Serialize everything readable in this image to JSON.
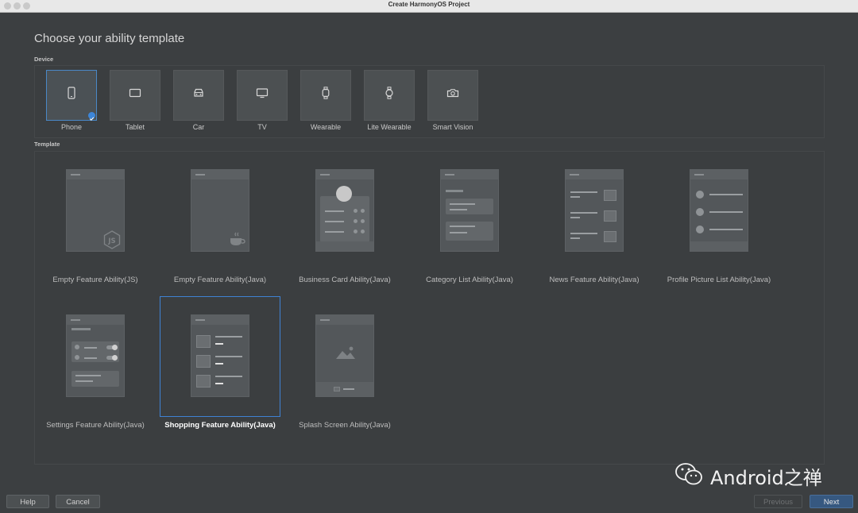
{
  "window": {
    "title": "Create HarmonyOS Project"
  },
  "heading": "Choose your ability template",
  "device_section_label": "Device",
  "template_section_label": "Template",
  "devices": [
    {
      "label": "Phone",
      "icon": "phone-icon",
      "selected": true
    },
    {
      "label": "Tablet",
      "icon": "tablet-icon",
      "selected": false
    },
    {
      "label": "Car",
      "icon": "car-icon",
      "selected": false
    },
    {
      "label": "TV",
      "icon": "tv-icon",
      "selected": false
    },
    {
      "label": "Wearable",
      "icon": "watch-icon",
      "selected": false
    },
    {
      "label": "Lite Wearable",
      "icon": "lite-watch-icon",
      "selected": false
    },
    {
      "label": "Smart Vision",
      "icon": "camera-icon",
      "selected": false
    }
  ],
  "templates": [
    {
      "label": "Empty Feature Ability(JS)",
      "selected": false
    },
    {
      "label": "Empty Feature Ability(Java)",
      "selected": false
    },
    {
      "label": "Business Card Ability(Java)",
      "selected": false
    },
    {
      "label": "Category List Ability(Java)",
      "selected": false
    },
    {
      "label": "News Feature Ability(Java)",
      "selected": false
    },
    {
      "label": "Profile Picture List Ability(Java)",
      "selected": false
    },
    {
      "label": "Settings Feature Ability(Java)",
      "selected": false
    },
    {
      "label": "Shopping Feature Ability(Java)",
      "selected": true
    },
    {
      "label": "Splash Screen Ability(Java)",
      "selected": false
    }
  ],
  "buttons": {
    "help": "Help",
    "cancel": "Cancel",
    "previous": "Previous",
    "next": "Next"
  },
  "watermark": {
    "text": "Android之禅"
  },
  "colors": {
    "accent": "#4a88c7",
    "background": "#3c3f41",
    "primary_button": "#365880"
  }
}
